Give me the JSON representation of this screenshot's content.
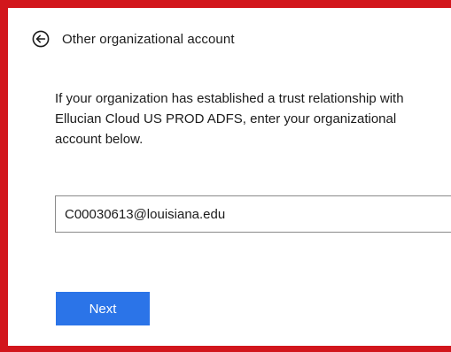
{
  "back_row": {
    "icon": "arrow-left-circle-icon",
    "label": "Other organizational account"
  },
  "description": "If your organization has established a trust relationship with Ellucian Cloud US PROD ADFS, enter your organizational account below.",
  "account_input": {
    "value": "C00030613@louisiana.edu",
    "placeholder": ""
  },
  "next_button": {
    "label": "Next"
  },
  "colors": {
    "frame_border": "#d2161c",
    "button_background": "#2b74e8",
    "text": "#1b1b1b"
  }
}
